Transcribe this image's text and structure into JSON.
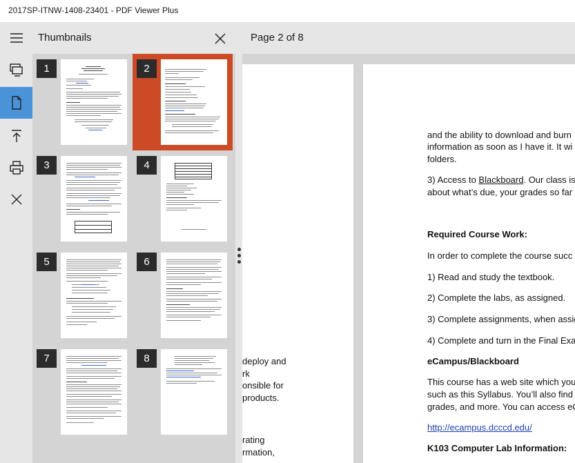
{
  "window": {
    "title": "2017SP-ITNW-1408-23401 - PDF Viewer Plus"
  },
  "rail": {
    "items": [
      {
        "name": "menu-icon"
      },
      {
        "name": "slideshow-icon"
      },
      {
        "name": "page-icon",
        "active": true
      },
      {
        "name": "go-to-top-icon"
      },
      {
        "name": "print-icon"
      },
      {
        "name": "close-icon"
      }
    ],
    "colors": {
      "active": "#4a93d8",
      "background": "#e6e6e6"
    }
  },
  "thumbnails": {
    "title": "Thumbnails",
    "selected_page": 2,
    "selected_color": "#cc4a25",
    "pages": [
      {
        "number": "1"
      },
      {
        "number": "2"
      },
      {
        "number": "3"
      },
      {
        "number": "4"
      },
      {
        "number": "5"
      },
      {
        "number": "6"
      },
      {
        "number": "7"
      },
      {
        "number": "8"
      }
    ]
  },
  "viewer": {
    "page_indicator": "Page 2 of 8",
    "left_page_fragments": [
      "deploy and",
      "rk",
      "onsible for",
      "products.",
      "rating",
      "rmation,"
    ],
    "right_page": {
      "lines": [
        "and the ability to download and burn",
        "information as soon as I have it. It wi",
        "folders."
      ],
      "blackboard_prefix": "3) Access to ",
      "blackboard_link": "Blackboard",
      "blackboard_suffix": ". Our class is",
      "blackboard_line2": "about what’s due, your grades so far",
      "required_heading": "Required Course Work:",
      "required_intro": "In order to complete the course succ",
      "item1": "1) Read and study the textbook.",
      "item2": "2) Complete the labs, as assigned.",
      "item3": "3) Complete assignments, when assig",
      "item4": "4) Complete and turn in the Final Exa",
      "ecampus_heading": "eCampus/Blackboard",
      "ecampus_line1": "This course has a web site which you",
      "ecampus_line2": "such as this Syllabus. You’ll also find",
      "ecampus_line3": "grades, and more. You can access eC",
      "ecampus_url": "http://ecampus.dcccd.edu/",
      "lab_heading": "K103 Computer Lab Information:"
    }
  }
}
